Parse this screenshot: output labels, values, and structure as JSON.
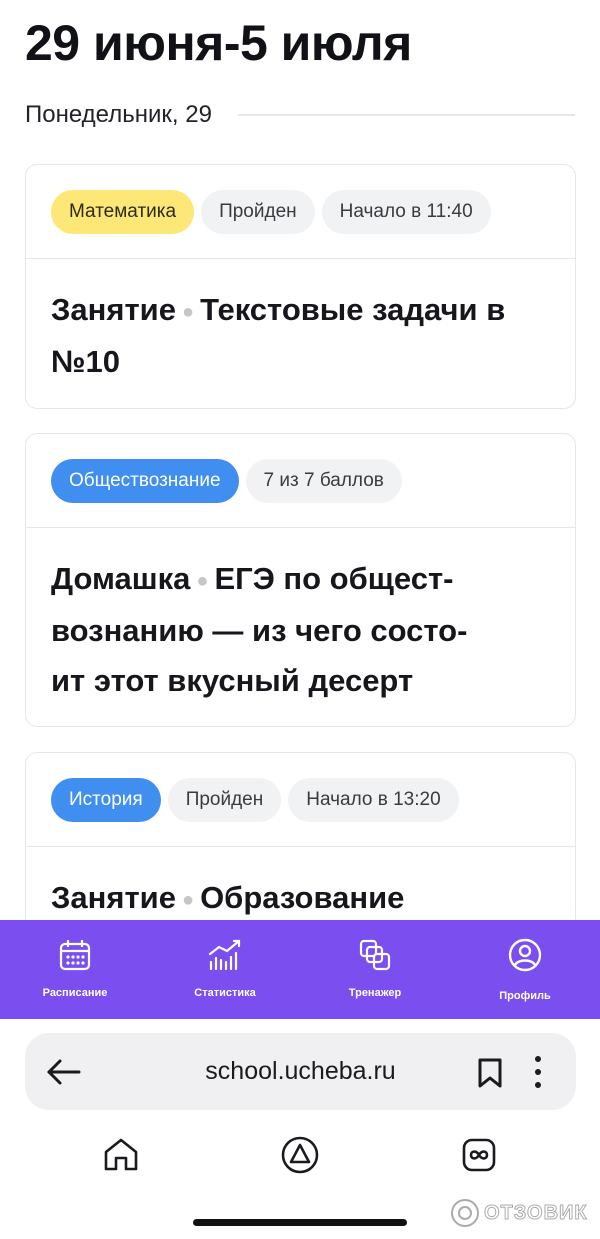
{
  "header": {
    "week_title": "29 июня-5 июля"
  },
  "day": {
    "label": "Понедельник, 29"
  },
  "cards": [
    {
      "tags": [
        "Математика",
        "Пройден",
        "Начало в 11:40"
      ],
      "kind": "Занятие",
      "title": "Текстовые задачи в №10"
    },
    {
      "tags": [
        "Обществознание",
        "7 из 7 баллов"
      ],
      "kind": "Домашка",
      "title": "ЕГЭ по общест-вознанию — из чего состо-ит этот вкусный десерт",
      "title_lines": [
        "ЕГЭ по общест-",
        "вознанию — из чего состо-",
        "ит этот вкусный десерт"
      ]
    },
    {
      "tags": [
        "История",
        "Пройден",
        "Начало в 13:20"
      ],
      "kind": "Занятие",
      "title": "Образование"
    }
  ],
  "bottom_nav": {
    "items": [
      {
        "label": "Расписание",
        "icon": "calendar-icon"
      },
      {
        "label": "Статистика",
        "icon": "stats-icon"
      },
      {
        "label": "Тренажер",
        "icon": "trainer-icon"
      },
      {
        "label": "Профиль",
        "icon": "profile-icon"
      }
    ],
    "color": "#7b4ef0"
  },
  "browser": {
    "url": "school.ucheba.ru"
  },
  "watermark": {
    "text": "ОТЗОВИК"
  },
  "colors": {
    "math_tag": "#fde877",
    "blue_tag": "#3f8ef0",
    "nav_bg": "#7b4ef0"
  }
}
